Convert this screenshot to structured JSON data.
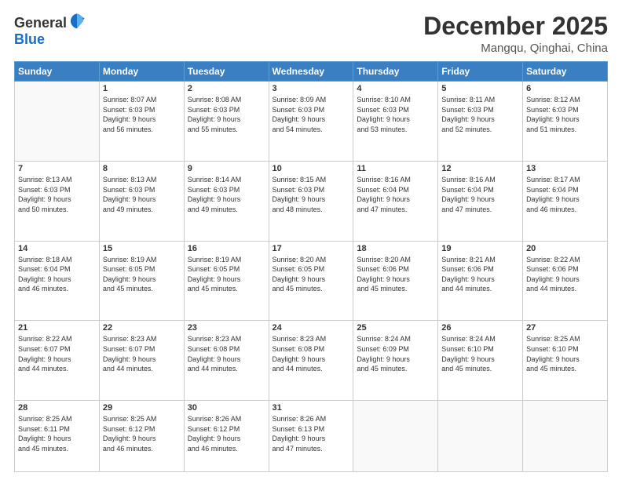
{
  "logo": {
    "general": "General",
    "blue": "Blue"
  },
  "title": "December 2025",
  "subtitle": "Mangqu, Qinghai, China",
  "calendar": {
    "headers": [
      "Sunday",
      "Monday",
      "Tuesday",
      "Wednesday",
      "Thursday",
      "Friday",
      "Saturday"
    ],
    "weeks": [
      [
        {
          "day": "",
          "info": ""
        },
        {
          "day": "1",
          "info": "Sunrise: 8:07 AM\nSunset: 6:03 PM\nDaylight: 9 hours\nand 56 minutes."
        },
        {
          "day": "2",
          "info": "Sunrise: 8:08 AM\nSunset: 6:03 PM\nDaylight: 9 hours\nand 55 minutes."
        },
        {
          "day": "3",
          "info": "Sunrise: 8:09 AM\nSunset: 6:03 PM\nDaylight: 9 hours\nand 54 minutes."
        },
        {
          "day": "4",
          "info": "Sunrise: 8:10 AM\nSunset: 6:03 PM\nDaylight: 9 hours\nand 53 minutes."
        },
        {
          "day": "5",
          "info": "Sunrise: 8:11 AM\nSunset: 6:03 PM\nDaylight: 9 hours\nand 52 minutes."
        },
        {
          "day": "6",
          "info": "Sunrise: 8:12 AM\nSunset: 6:03 PM\nDaylight: 9 hours\nand 51 minutes."
        }
      ],
      [
        {
          "day": "7",
          "info": "Sunrise: 8:13 AM\nSunset: 6:03 PM\nDaylight: 9 hours\nand 50 minutes."
        },
        {
          "day": "8",
          "info": "Sunrise: 8:13 AM\nSunset: 6:03 PM\nDaylight: 9 hours\nand 49 minutes."
        },
        {
          "day": "9",
          "info": "Sunrise: 8:14 AM\nSunset: 6:03 PM\nDaylight: 9 hours\nand 49 minutes."
        },
        {
          "day": "10",
          "info": "Sunrise: 8:15 AM\nSunset: 6:03 PM\nDaylight: 9 hours\nand 48 minutes."
        },
        {
          "day": "11",
          "info": "Sunrise: 8:16 AM\nSunset: 6:04 PM\nDaylight: 9 hours\nand 47 minutes."
        },
        {
          "day": "12",
          "info": "Sunrise: 8:16 AM\nSunset: 6:04 PM\nDaylight: 9 hours\nand 47 minutes."
        },
        {
          "day": "13",
          "info": "Sunrise: 8:17 AM\nSunset: 6:04 PM\nDaylight: 9 hours\nand 46 minutes."
        }
      ],
      [
        {
          "day": "14",
          "info": "Sunrise: 8:18 AM\nSunset: 6:04 PM\nDaylight: 9 hours\nand 46 minutes."
        },
        {
          "day": "15",
          "info": "Sunrise: 8:19 AM\nSunset: 6:05 PM\nDaylight: 9 hours\nand 45 minutes."
        },
        {
          "day": "16",
          "info": "Sunrise: 8:19 AM\nSunset: 6:05 PM\nDaylight: 9 hours\nand 45 minutes."
        },
        {
          "day": "17",
          "info": "Sunrise: 8:20 AM\nSunset: 6:05 PM\nDaylight: 9 hours\nand 45 minutes."
        },
        {
          "day": "18",
          "info": "Sunrise: 8:20 AM\nSunset: 6:06 PM\nDaylight: 9 hours\nand 45 minutes."
        },
        {
          "day": "19",
          "info": "Sunrise: 8:21 AM\nSunset: 6:06 PM\nDaylight: 9 hours\nand 44 minutes."
        },
        {
          "day": "20",
          "info": "Sunrise: 8:22 AM\nSunset: 6:06 PM\nDaylight: 9 hours\nand 44 minutes."
        }
      ],
      [
        {
          "day": "21",
          "info": "Sunrise: 8:22 AM\nSunset: 6:07 PM\nDaylight: 9 hours\nand 44 minutes."
        },
        {
          "day": "22",
          "info": "Sunrise: 8:23 AM\nSunset: 6:07 PM\nDaylight: 9 hours\nand 44 minutes."
        },
        {
          "day": "23",
          "info": "Sunrise: 8:23 AM\nSunset: 6:08 PM\nDaylight: 9 hours\nand 44 minutes."
        },
        {
          "day": "24",
          "info": "Sunrise: 8:23 AM\nSunset: 6:08 PM\nDaylight: 9 hours\nand 44 minutes."
        },
        {
          "day": "25",
          "info": "Sunrise: 8:24 AM\nSunset: 6:09 PM\nDaylight: 9 hours\nand 45 minutes."
        },
        {
          "day": "26",
          "info": "Sunrise: 8:24 AM\nSunset: 6:10 PM\nDaylight: 9 hours\nand 45 minutes."
        },
        {
          "day": "27",
          "info": "Sunrise: 8:25 AM\nSunset: 6:10 PM\nDaylight: 9 hours\nand 45 minutes."
        }
      ],
      [
        {
          "day": "28",
          "info": "Sunrise: 8:25 AM\nSunset: 6:11 PM\nDaylight: 9 hours\nand 45 minutes."
        },
        {
          "day": "29",
          "info": "Sunrise: 8:25 AM\nSunset: 6:12 PM\nDaylight: 9 hours\nand 46 minutes."
        },
        {
          "day": "30",
          "info": "Sunrise: 8:26 AM\nSunset: 6:12 PM\nDaylight: 9 hours\nand 46 minutes."
        },
        {
          "day": "31",
          "info": "Sunrise: 8:26 AM\nSunset: 6:13 PM\nDaylight: 9 hours\nand 47 minutes."
        },
        {
          "day": "",
          "info": ""
        },
        {
          "day": "",
          "info": ""
        },
        {
          "day": "",
          "info": ""
        }
      ]
    ]
  }
}
